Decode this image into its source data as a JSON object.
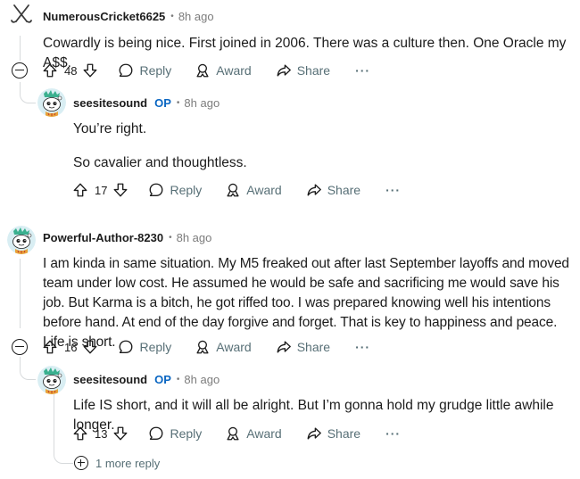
{
  "comments": [
    {
      "username": "NumerousCricket6625",
      "op_badge": "",
      "time": "8h ago",
      "paragraphs": [
        "Cowardly is being nice. First joined in 2006. There was a culture then. One Oracle my A$$."
      ],
      "score": "48",
      "avatar_icon": "crossed-sticks-icon"
    },
    {
      "username": "seesitesound",
      "op_badge": "OP",
      "time": "8h ago",
      "paragraphs": [
        "You’re right.",
        "So cavalier and thoughtless."
      ],
      "score": "17",
      "avatar_icon": "snoo-avatar-icon"
    },
    {
      "username": "Powerful-Author-8230",
      "op_badge": "",
      "time": "8h ago",
      "paragraphs": [
        "I am kinda in same situation. My M5 freaked out after last September layoffs and moved team under low cost. He assumed he would be safe and sacrificing me would save his job. But Karma is a bitch, he got riffed too. I was prepared knowing well his intentions before hand. At end of the day forgive and forget. That is key to happiness and peace. Life is short."
      ],
      "score": "16",
      "avatar_icon": "snoo-avatar-icon"
    },
    {
      "username": "seesitesound",
      "op_badge": "OP",
      "time": "8h ago",
      "paragraphs": [
        "Life IS short, and it will all be alright. But I’m gonna hold my grudge little awhile longer."
      ],
      "score": "13",
      "avatar_icon": "snoo-avatar-icon"
    }
  ],
  "actions": {
    "reply": "Reply",
    "award": "Award",
    "share": "Share",
    "more": "···"
  },
  "more_replies": "1 more reply",
  "colors": {
    "text": "#1c1c1c",
    "muted": "#576f76",
    "op_blue": "#0a66c2",
    "thread_line": "#d7dadc"
  }
}
